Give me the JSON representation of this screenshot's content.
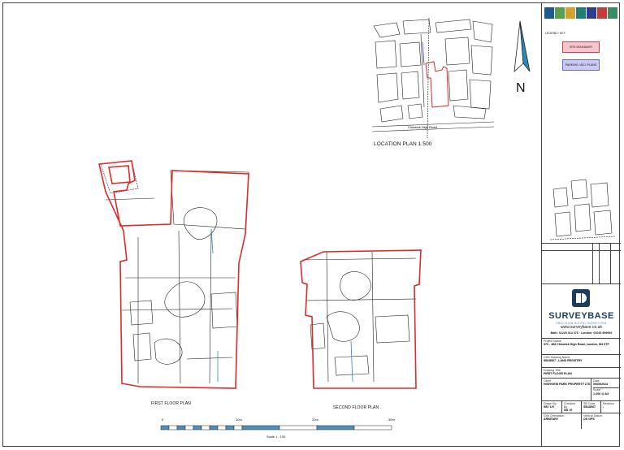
{
  "title_block": {
    "legend_heading": "LEGEND / KEY",
    "legend_items": [
      {
        "label": "SITE BOUNDARY",
        "color": "#e0394a",
        "fill": "#f7c6cc"
      },
      {
        "label": "PARKING / ADJ. PLANS",
        "color": "#6a6ad0",
        "fill": "#c9c9f2"
      }
    ],
    "company_name": "SURVEYBASE",
    "company_tagline": "PRECISION DIGITAL SURVEYORS",
    "website": "www.surveybase.co.uk",
    "contact": "Bath: 01225 314 376 · London: 02035 999992",
    "project_name_label": "Project Name",
    "project_name": "370 - 384 Chiswick High Road, London, W4 5TF",
    "cad_drawing_name_label": "CAD Drawing Name",
    "cad_drawing_name": "SB18507 - LAND REGISTRY",
    "drawing_title_label": "Drawing Title",
    "drawing_title": "FIRST FLOOR PLAN",
    "client_label": "Client",
    "client": "HIGHVIEW PARK PROPERTY LTD",
    "date_label": "Date",
    "date": "09/05/2024",
    "scale_label": "Scale",
    "scale": "1:100 @ A3",
    "drawn_by_label": "Drawn By",
    "drawn_by": "SB / LH",
    "checked_by_label": "Checked By",
    "checked_by": "SB / E",
    "job_code_label": "SB Code",
    "job_code": "SB18507",
    "revision_label": "Revision",
    "revision": "-",
    "grid_orientation_label": "Grid Orientation",
    "grid_orientation": "ARBITARY",
    "vertical_datum_label": "Vertical Datum",
    "vertical_datum": "OS GPS"
  },
  "logo_colors": [
    "#1d5c8a",
    "#5aa04a",
    "#d7a02c",
    "#1f7d7a",
    "#2f3d8f",
    "#c73a3a",
    "#3a8a6a"
  ],
  "location_plan": {
    "label": "LOCATION PLAN 1:500",
    "north_label": "N"
  },
  "plans": [
    {
      "label": "FIRST FLOOR PLAN"
    },
    {
      "label": "SECOND FLOOR PLAN"
    }
  ],
  "scale_bar": {
    "ticks": [
      "0",
      "10m",
      "20m",
      "30m"
    ],
    "caption": "Scale 1 : 100",
    "fill_color": "#4a8fc0"
  },
  "colors": {
    "boundary": "#e02a2a",
    "accent_blue": "#2b8ab8"
  }
}
